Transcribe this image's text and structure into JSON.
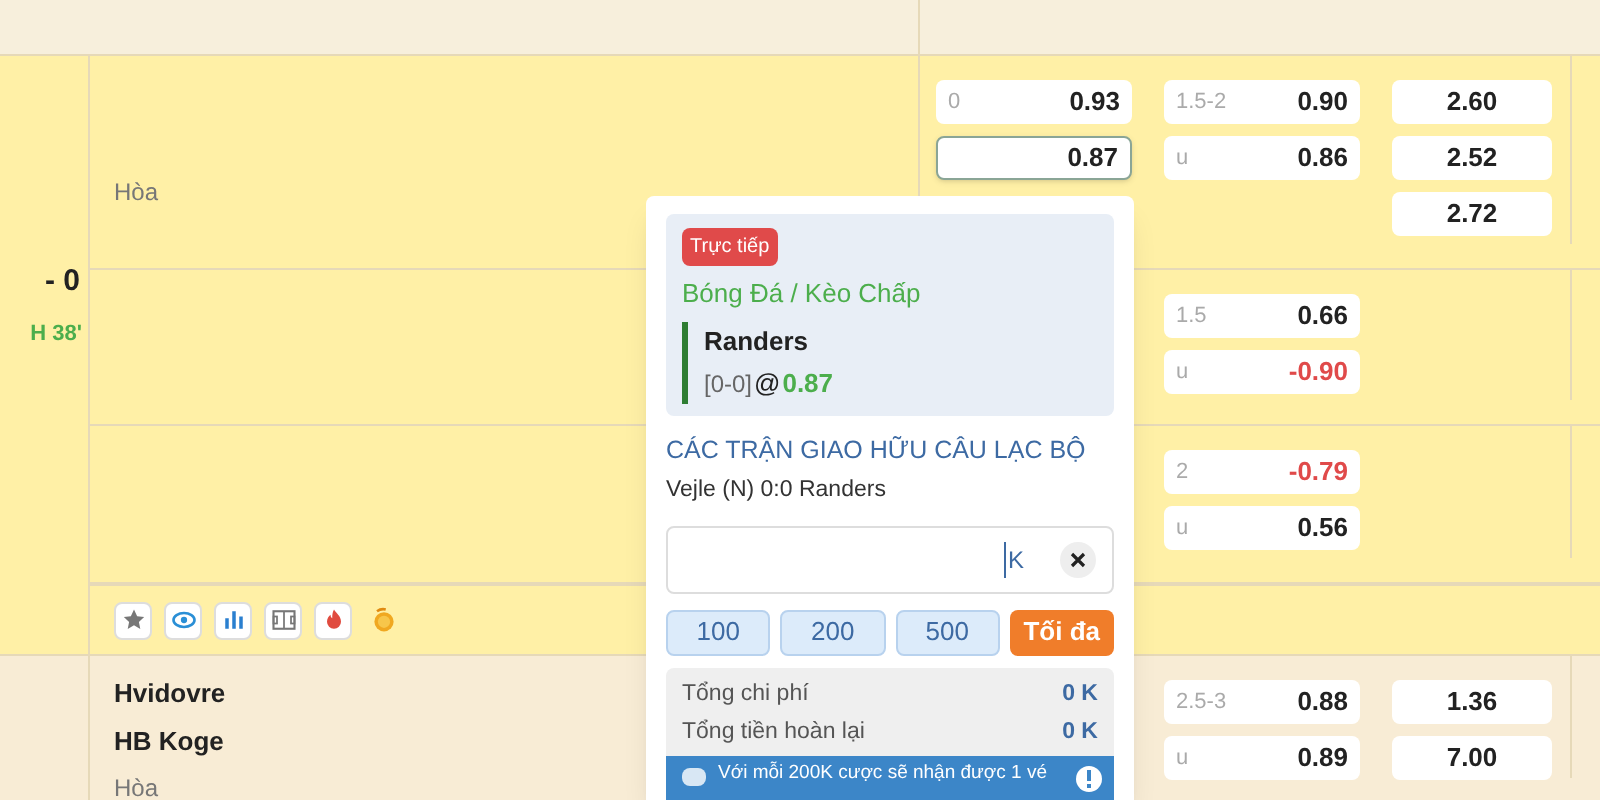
{
  "matches": [
    {
      "score": "- 0",
      "time": "H 38'",
      "draw_label": "Hòa",
      "rows": [
        {
          "handicap": [
            {
              "line": "0",
              "odds": "0.93",
              "negative": false,
              "selected": false
            },
            {
              "odds": "0.87",
              "negative": false,
              "selected": true
            }
          ],
          "over_under": [
            {
              "line": "1.5-2",
              "odds": "0.90",
              "negative": false,
              "selected": false
            },
            {
              "line": "u",
              "odds": "0.86",
              "negative": false,
              "selected": false
            }
          ],
          "one_x_two": [
            "2.60",
            "2.52",
            "2.72"
          ]
        },
        {
          "over_under": [
            {
              "line": "1.5",
              "odds": "0.66",
              "negative": false,
              "selected": false
            },
            {
              "line": "u",
              "odds": "-0.90",
              "negative": true,
              "selected": false
            }
          ]
        },
        {
          "over_under": [
            {
              "line": "2",
              "odds": "-0.79",
              "negative": true,
              "selected": false
            },
            {
              "line": "u",
              "odds": "0.56",
              "negative": false,
              "selected": false
            }
          ]
        }
      ],
      "tools": [
        {
          "kind": "star"
        },
        {
          "kind": "eye"
        },
        {
          "kind": "stats"
        },
        {
          "kind": "field"
        },
        {
          "kind": "fire"
        },
        {
          "kind": "coin"
        }
      ]
    },
    {
      "teams": [
        "Hvidovre",
        "HB Koge"
      ],
      "draw_label": "Hòa",
      "rows": [
        {
          "over_under": [
            {
              "line": "2.5-3",
              "odds": "0.88",
              "negative": false,
              "selected": false
            },
            {
              "line": "u",
              "odds": "0.89",
              "negative": false,
              "selected": false
            }
          ],
          "one_x_two": [
            "1.36",
            "7.00"
          ]
        }
      ]
    }
  ],
  "bet_slip": {
    "badge": "Trực tiếp",
    "market": "Bóng Đá / Kèo Chấp",
    "selection": "Randers",
    "score": "[0-0]",
    "at": "@",
    "odds": "0.87",
    "league": "CÁC TRẬN GIAO HỮU CÂU LẠC BỘ",
    "fixture": "Vejle (N) 0:0 Randers",
    "stake": {
      "unit": "K"
    },
    "quick_amounts": [
      "100",
      "200",
      "500"
    ],
    "max_label": "Tối đa",
    "summary": [
      {
        "label": "Tổng chi phí",
        "value": "0 K"
      },
      {
        "label": "Tổng tiền hoàn lại",
        "value": "0 K"
      }
    ],
    "banner": "Với mỗi 200K cược sẽ nhận được 1 vé"
  }
}
